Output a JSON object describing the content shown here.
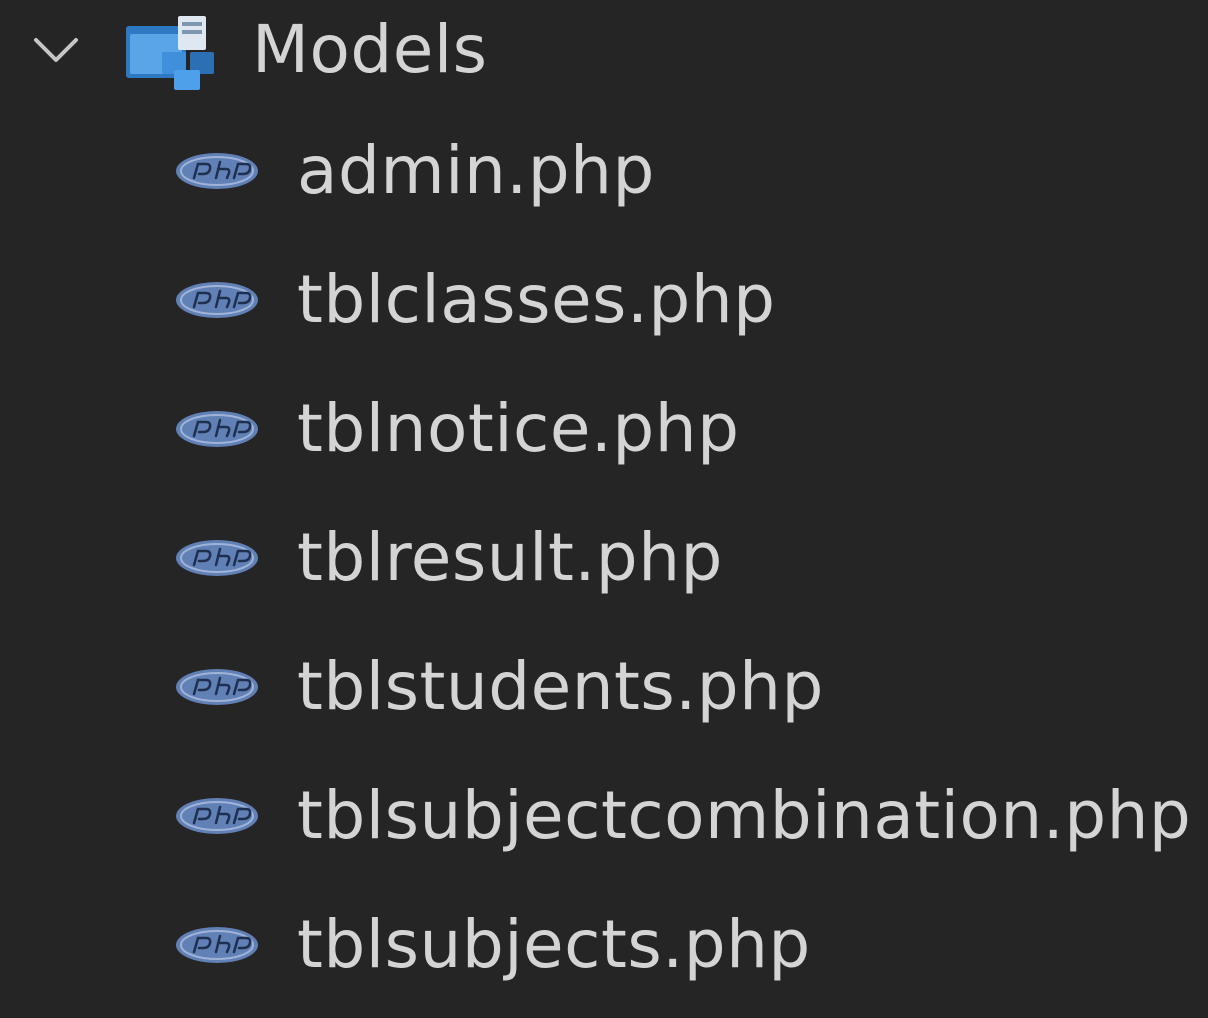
{
  "explorer": {
    "folder": {
      "name": "Models",
      "expanded": true,
      "chevron_icon": "chevron-down-icon",
      "folder_icon": "models-folder-icon"
    },
    "files": [
      {
        "name": "admin.php",
        "icon": "php-file-icon"
      },
      {
        "name": "tblclasses.php",
        "icon": "php-file-icon"
      },
      {
        "name": "tblnotice.php",
        "icon": "php-file-icon"
      },
      {
        "name": "tblresult.php",
        "icon": "php-file-icon"
      },
      {
        "name": "tblstudents.php",
        "icon": "php-file-icon"
      },
      {
        "name": "tblsubjectcombination.php",
        "icon": "php-file-icon"
      },
      {
        "name": "tblsubjects.php",
        "icon": "php-file-icon"
      }
    ]
  },
  "colors": {
    "background": "#252526",
    "text": "#d4d4d4",
    "php_icon": "#6181b6",
    "folder_icon": "#3a8fd6"
  }
}
